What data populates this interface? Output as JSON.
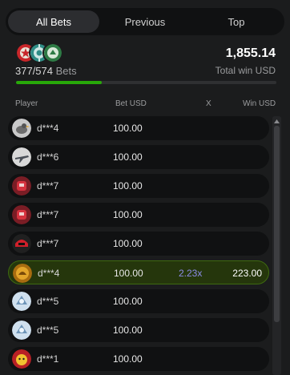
{
  "tabs": [
    {
      "label": "All Bets",
      "active": true
    },
    {
      "label": "Previous",
      "active": false
    },
    {
      "label": "Top",
      "active": false
    }
  ],
  "summary": {
    "bets_shown": "377/574",
    "bets_word": "Bets",
    "total_win": "1,855.14",
    "total_win_label": "Total win USD",
    "progress_fraction": 0.33,
    "colors": {
      "progress": "#28a909"
    }
  },
  "columns": {
    "player": "Player",
    "bet": "Bet USD",
    "multiplier": "X",
    "win": "Win USD"
  },
  "rows": [
    {
      "player": "d***4",
      "bet": "100.00",
      "multiplier": "",
      "win": "",
      "avatar": "bird-avatar-icon",
      "highlight": false
    },
    {
      "player": "d***6",
      "bet": "100.00",
      "multiplier": "",
      "win": "",
      "avatar": "jet-avatar-icon",
      "highlight": false
    },
    {
      "player": "d***7",
      "bet": "100.00",
      "multiplier": "",
      "win": "",
      "avatar": "red-robot-avatar-icon",
      "highlight": false
    },
    {
      "player": "d***7",
      "bet": "100.00",
      "multiplier": "",
      "win": "",
      "avatar": "red-robot-avatar-icon",
      "highlight": false
    },
    {
      "player": "d***7",
      "bet": "100.00",
      "multiplier": "",
      "win": "",
      "avatar": "red-helmet-avatar-icon",
      "highlight": false
    },
    {
      "player": "d***4",
      "bet": "100.00",
      "multiplier": "2.23x",
      "win": "223.00",
      "avatar": "gold-avatar-icon",
      "highlight": true
    },
    {
      "player": "d***5",
      "bet": "100.00",
      "multiplier": "",
      "win": "",
      "avatar": "blue-robot-avatar-icon",
      "highlight": false
    },
    {
      "player": "d***5",
      "bet": "100.00",
      "multiplier": "",
      "win": "",
      "avatar": "blue-robot-avatar-icon",
      "highlight": false
    },
    {
      "player": "d***1",
      "bet": "100.00",
      "multiplier": "",
      "win": "",
      "avatar": "yellow-face-avatar-icon",
      "highlight": false
    }
  ]
}
